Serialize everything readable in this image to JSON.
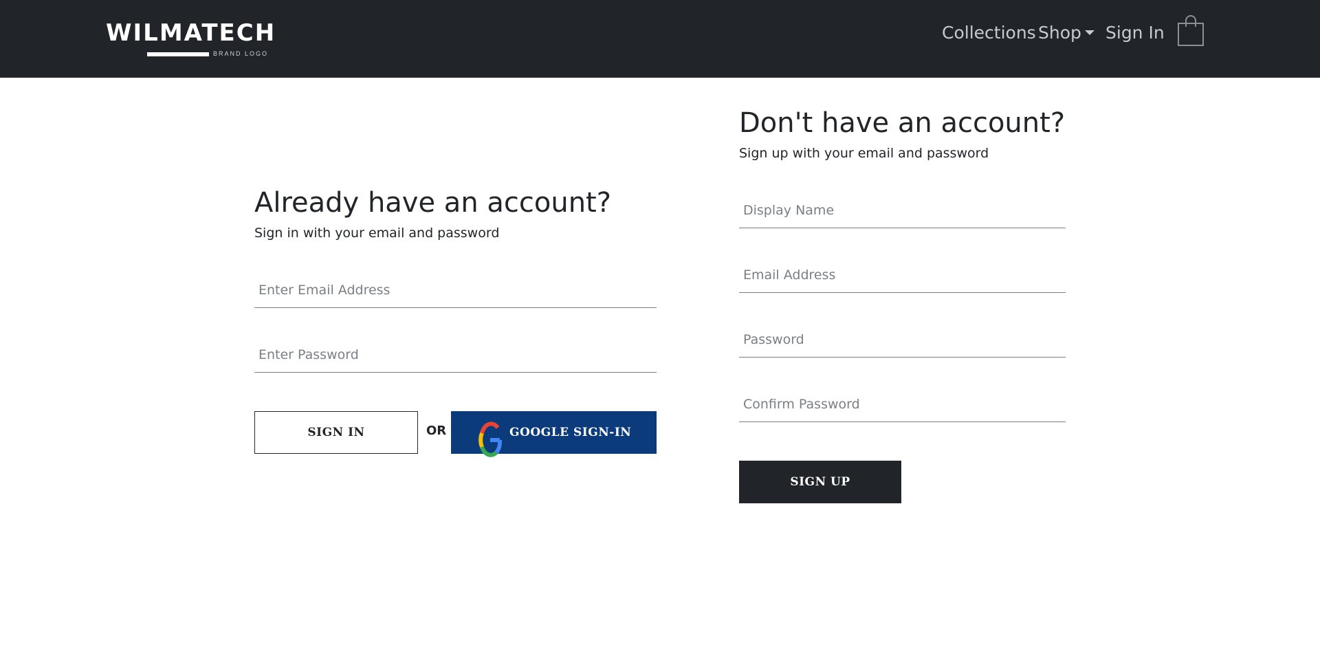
{
  "navbar": {
    "brand": {
      "name": "WILMATECH",
      "tagline": "BRAND LOGO"
    },
    "links": {
      "collections": "Collections",
      "shop": "Shop",
      "sign_in": "Sign In"
    },
    "cart_icon": "shopping-bag-icon",
    "colors": {
      "background": "#212529",
      "link": "#c7cacf"
    }
  },
  "sign_in": {
    "title": "Already have an account?",
    "subtitle": "Sign in with your email and password",
    "email": {
      "placeholder": "Enter Email Address",
      "value": ""
    },
    "password": {
      "placeholder": "Enter Password",
      "value": ""
    },
    "submit_label": "SIGN IN",
    "or_label": "OR",
    "google_label": "GOOGLE SIGN-IN",
    "google_icon": "google-g-icon",
    "google_color": "#0b3b7a"
  },
  "sign_up": {
    "title": "Don't have an account?",
    "subtitle": "Sign up with your email and password",
    "display_name": {
      "placeholder": "Display Name",
      "value": ""
    },
    "email": {
      "placeholder": "Email Address",
      "value": ""
    },
    "password": {
      "placeholder": "Password",
      "value": ""
    },
    "confirm_password": {
      "placeholder": "Confirm Password",
      "value": ""
    },
    "submit_label": "SIGN UP",
    "button_color": "#212529"
  }
}
